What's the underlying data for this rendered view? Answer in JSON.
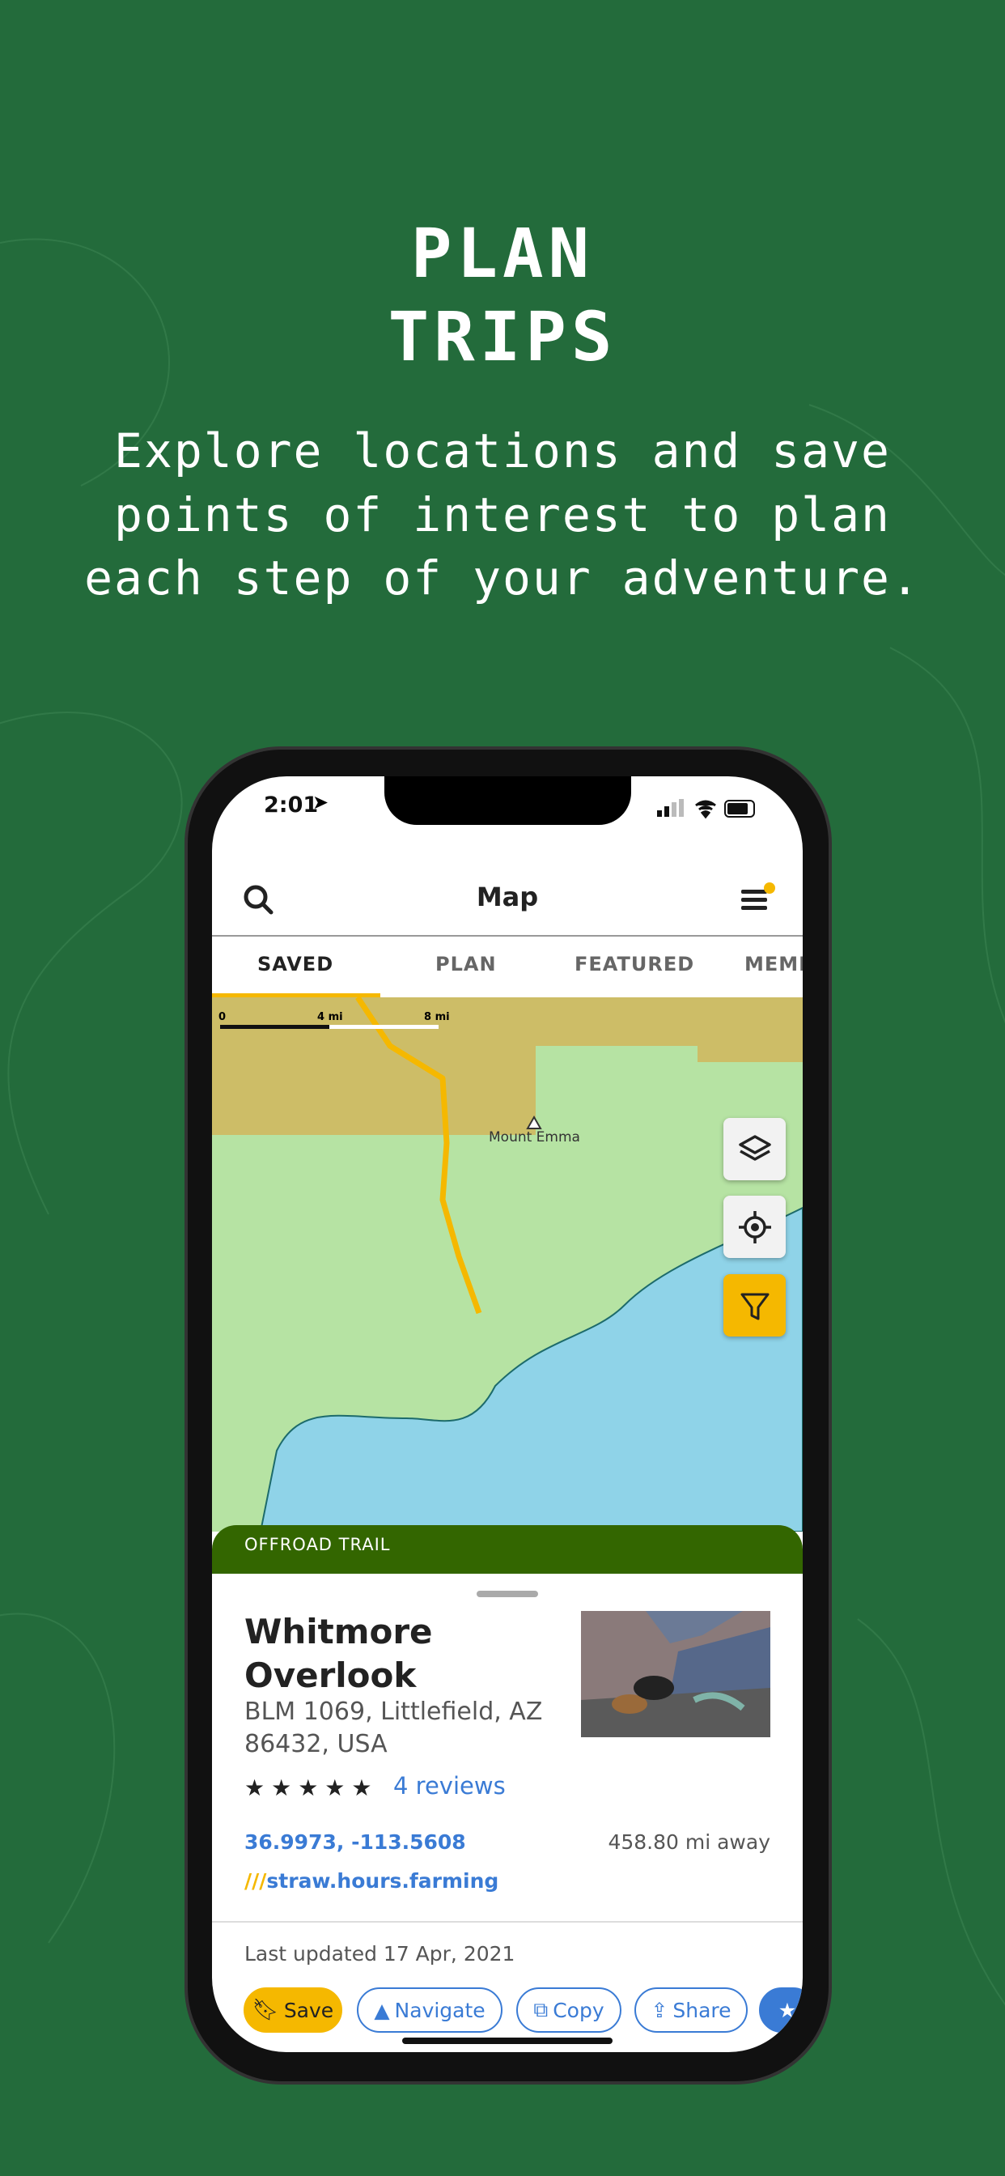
{
  "promo": {
    "title_line1": "PLAN",
    "title_line2": "TRIPS",
    "subtitle_lines": [
      "Explore locations and save",
      "points of interest to plan",
      "each step of your adventure."
    ]
  },
  "status_bar": {
    "time": "2:01"
  },
  "header": {
    "title": "Map",
    "search_icon": "search-icon",
    "menu_icon": "menu-icon",
    "notification_color": "#f5b800"
  },
  "tabs": [
    {
      "label": "SAVED",
      "active": true
    },
    {
      "label": "PLAN"
    },
    {
      "label": "FEATURED"
    },
    {
      "label": "MEMBERS"
    }
  ],
  "map": {
    "scale_labels": [
      "0",
      "4 mi",
      "8 mi"
    ],
    "place_label": "Mount Emma",
    "accent": "#f5b800"
  },
  "card": {
    "category": "OFFROAD TRAIL",
    "title": "Whitmore Overlook",
    "address": "BLM 1069, Littlefield, AZ 86432, USA",
    "rating": 5,
    "reviews": "4 reviews",
    "coordinates": "36.9973, -113.5608",
    "distance": "458.80 mi away",
    "w3w_prefix": "///",
    "w3w": "straw.hours.farming",
    "last_updated": "Last updated 17 Apr, 2021"
  },
  "actions": {
    "save": "Save",
    "navigate": "Navigate",
    "copy": "Copy",
    "share": "Share"
  },
  "colors": {
    "background": "#236b3b",
    "category_bar": "#336600",
    "link": "#3a7bd5",
    "save": "#f5b800"
  }
}
